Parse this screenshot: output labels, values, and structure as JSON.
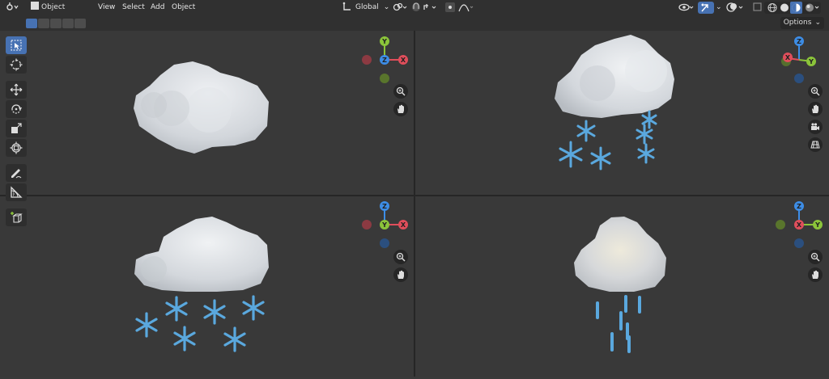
{
  "header": {
    "mode_label": "Object Mode",
    "menus": [
      "View",
      "Select",
      "Add",
      "Object"
    ],
    "transform_orientation": "Global",
    "options_label": "Options"
  },
  "axis_labels": {
    "x": "X",
    "y": "Y",
    "z": "Z"
  },
  "colors": {
    "accent": "#4772b3",
    "x_axis": "#e04e5b",
    "y_axis": "#8bc43a",
    "z_axis": "#3d8de6",
    "snow": "#5aa8de",
    "cloud": "#d5d9de"
  },
  "icons": [
    "editor-type-icon",
    "object-mode-icon",
    "transform-orientation-icon",
    "pivot-icon",
    "snap-icon",
    "proportional-icon",
    "visibility-icon",
    "gizmo-icon",
    "overlay-icon",
    "xray-icon",
    "wireframe-shading-icon",
    "solid-shading-icon",
    "material-shading-icon",
    "rendered-shading-icon",
    "select-box-icon",
    "cursor-icon",
    "move-icon",
    "rotate-icon",
    "scale-icon",
    "transform-icon",
    "annotate-icon",
    "measure-icon",
    "add-cube-icon",
    "zoom-icon",
    "hand-icon",
    "camera-icon",
    "perspective-grid-icon"
  ]
}
